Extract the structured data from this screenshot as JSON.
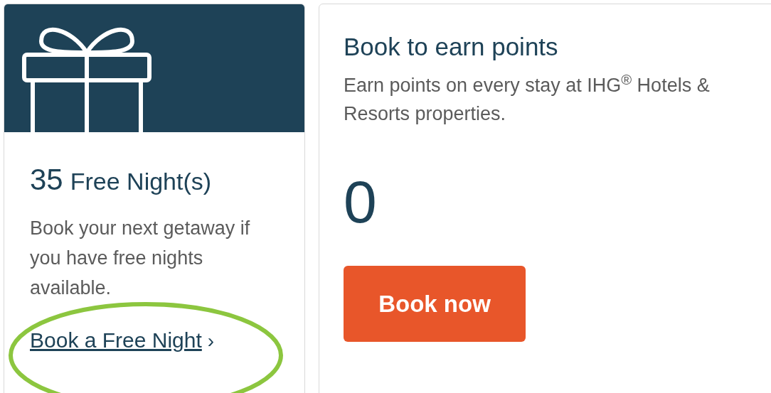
{
  "free_nights_card": {
    "count": "35",
    "label": "Free Night(s)",
    "description": "Book your next getaway if you have free nights available.",
    "link": "Book a Free Night",
    "link_chevron": "›"
  },
  "earn_points_card": {
    "title": "Book to earn points",
    "description": "Earn points on every stay at IHG$^{®}$ Hotels & Resorts properties.",
    "points": "0",
    "button": "Book now"
  }
}
